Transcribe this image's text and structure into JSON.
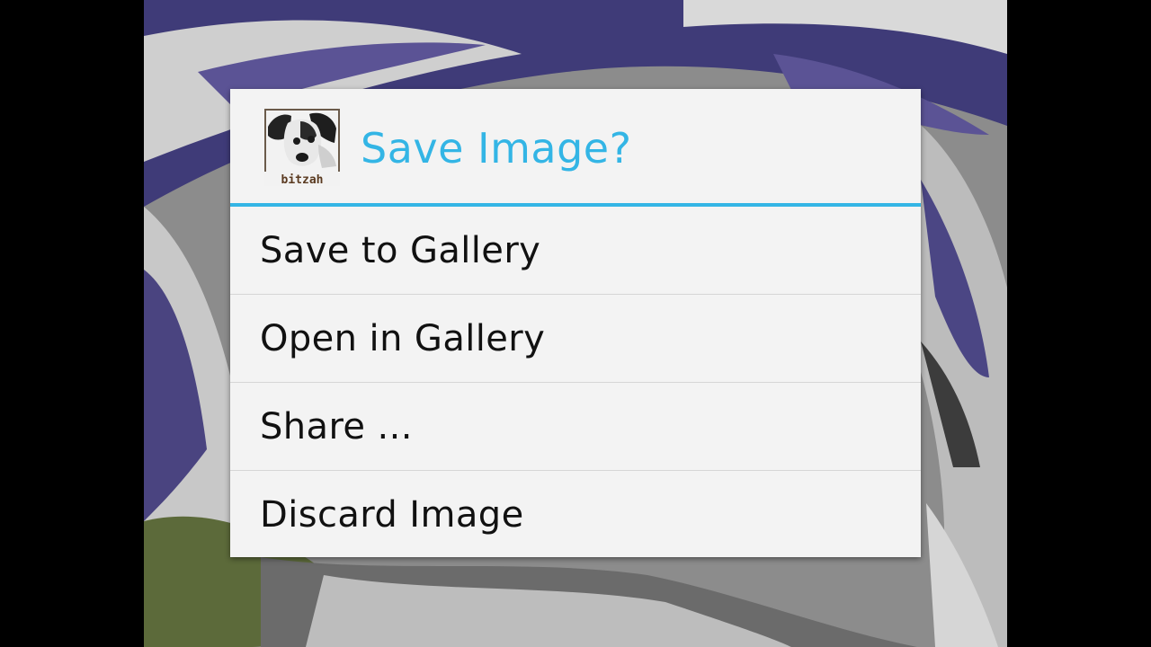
{
  "dialog": {
    "title": "Save Image?",
    "icon": "dog-app-icon",
    "icon_caption": "bitzah",
    "options": [
      {
        "label": "Save to Gallery"
      },
      {
        "label": "Open in Gallery"
      },
      {
        "label": "Share ..."
      },
      {
        "label": "Discard Image"
      }
    ]
  },
  "colors": {
    "accent": "#33b5e5",
    "dialog_background": "#f3f3f3",
    "option_text": "#111111",
    "divider": "#d6d6d6"
  }
}
